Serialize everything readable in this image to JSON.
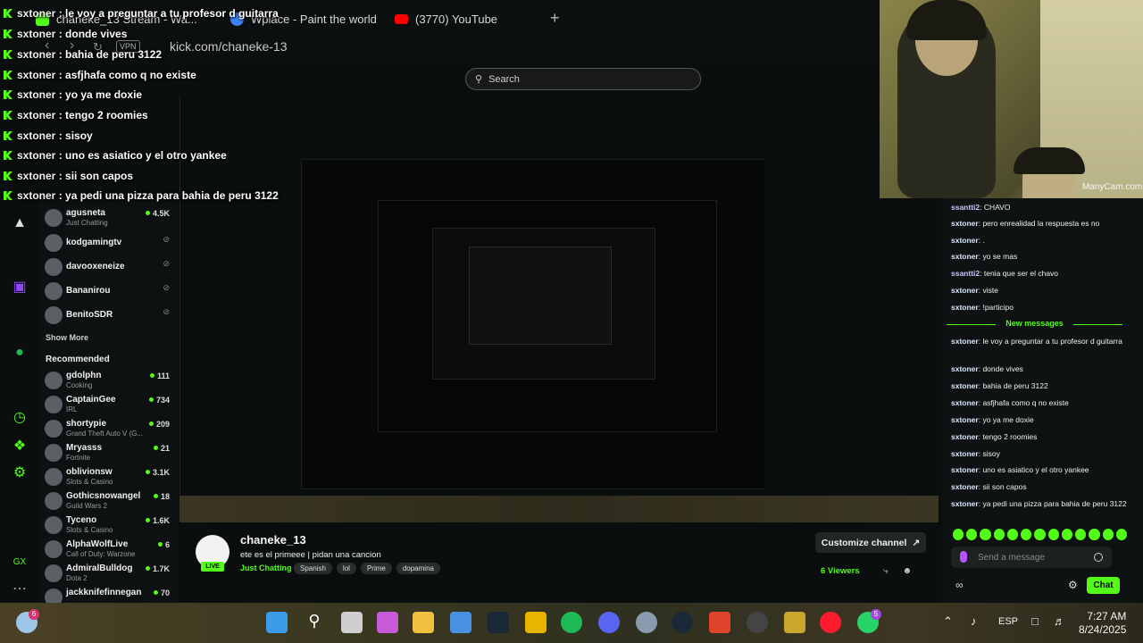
{
  "browser": {
    "tabs": [
      {
        "label": "chaneke_13 Stream - Wa...",
        "color": "#53fc18"
      },
      {
        "label": "Wplace - Paint the world",
        "color": "#3b82f6"
      },
      {
        "label": "(3770) YouTube",
        "color": "#ff0000"
      }
    ],
    "new_tab": "+",
    "vpn": "VPN",
    "url": "kick.com/chaneke-13"
  },
  "kick": {
    "search_placeholder": "Search"
  },
  "overlay_chat": [
    {
      "user": "sxtoner",
      "msg": "le voy a preguntar a tu profesor d guitarra"
    },
    {
      "user": "sxtoner",
      "msg": "donde vives"
    },
    {
      "user": "sxtoner",
      "msg": "bahia de peru 3122"
    },
    {
      "user": "sxtoner",
      "msg": "asfjhafa como q no existe"
    },
    {
      "user": "sxtoner",
      "msg": "yo ya me doxie"
    },
    {
      "user": "sxtoner",
      "msg": "tengo 2 roomies"
    },
    {
      "user": "sxtoner",
      "msg": "sisoy"
    },
    {
      "user": "sxtoner",
      "msg": "uno es asiatico y el otro yankee"
    },
    {
      "user": "sxtoner",
      "msg": "sii son capos"
    },
    {
      "user": "sxtoner",
      "msg": "ya pedi una pizza para bahia de peru 3122"
    }
  ],
  "sidebar": {
    "following": [
      {
        "name": "agusneta",
        "game": "Just Chatting",
        "viewers": "4.5K",
        "live": true
      },
      {
        "name": "kodgamingtv",
        "game": "",
        "viewers": "",
        "live": false
      },
      {
        "name": "davooxeneize",
        "game": "",
        "viewers": "",
        "live": false
      },
      {
        "name": "Bananirou",
        "game": "",
        "viewers": "",
        "live": false
      },
      {
        "name": "BenitoSDR",
        "game": "",
        "viewers": "",
        "live": false
      }
    ],
    "show_more": "Show More",
    "recommended_title": "Recommended",
    "recommended": [
      {
        "name": "gdolphn",
        "game": "Cooking",
        "viewers": "111"
      },
      {
        "name": "CaptainGee",
        "game": "IRL",
        "viewers": "734"
      },
      {
        "name": "shortypie",
        "game": "Grand Theft Auto V (G...",
        "viewers": "209"
      },
      {
        "name": "Mryasss",
        "game": "Fortnite",
        "viewers": "21"
      },
      {
        "name": "oblivionsw",
        "game": "Slots & Casino",
        "viewers": "3.1K"
      },
      {
        "name": "Gothicsnowangel",
        "game": "Guild Wars 2",
        "viewers": "18"
      },
      {
        "name": "Tyceno",
        "game": "Slots & Casino",
        "viewers": "1.6K"
      },
      {
        "name": "AlphaWolfLive",
        "game": "Call of Duty: Warzone",
        "viewers": "6"
      },
      {
        "name": "AdmiralBulldog",
        "game": "Dota 2",
        "viewers": "1.7K"
      },
      {
        "name": "jackknifefinnegan",
        "game": "",
        "viewers": "70"
      }
    ]
  },
  "webcam": {
    "watermark": "ManyCam.com"
  },
  "chat": {
    "messages_before": [
      {
        "user": "ssantti2",
        "msg": "CHAVO"
      },
      {
        "user": "sxtoner",
        "msg": "pero enrealidad la respuesta es no"
      },
      {
        "user": "sxtoner",
        "msg": "."
      },
      {
        "user": "sxtoner",
        "msg": "yo se mas"
      },
      {
        "user": "ssantti2",
        "msg": "tenia que ser el chavo"
      },
      {
        "user": "sxtoner",
        "msg": "viste"
      },
      {
        "user": "sxtoner",
        "msg": "!participo"
      }
    ],
    "new_messages_label": "New messages",
    "messages_after": [
      {
        "user": "sxtoner",
        "msg": "le voy a preguntar a tu profesor d guitarra"
      },
      {
        "user": "sxtoner",
        "msg": "donde vives"
      },
      {
        "user": "sxtoner",
        "msg": "bahia de peru 3122"
      },
      {
        "user": "sxtoner",
        "msg": "asfjhafa como q no existe"
      },
      {
        "user": "sxtoner",
        "msg": "yo ya me doxie"
      },
      {
        "user": "sxtoner",
        "msg": "tengo 2 roomies"
      },
      {
        "user": "sxtoner",
        "msg": "sisoy"
      },
      {
        "user": "sxtoner",
        "msg": "uno es asiatico y el otro yankee"
      },
      {
        "user": "sxtoner",
        "msg": "sii son capos"
      },
      {
        "user": "sxtoner",
        "msg": "ya pedi una pizza para bahia de peru 3122"
      }
    ],
    "input_placeholder": "Send a message",
    "send_button": "Chat"
  },
  "channel": {
    "name": "chaneke_13",
    "title": "ete es el primeee | pidan una cancion",
    "category": "Just Chatting",
    "tags": [
      "Spanish",
      "lol",
      "Prime",
      "dopamina"
    ],
    "customize_button": "Customize channel",
    "viewers": "6 Viewers",
    "live_badge": "LIVE"
  },
  "taskbar": {
    "language": "ESP",
    "time": "7:27 AM",
    "date": "8/24/2025",
    "weather_badge": "6",
    "whatsapp_badge": "5"
  },
  "colors": {
    "kick_green": "#53fc18",
    "background": "#0b0e0f"
  }
}
